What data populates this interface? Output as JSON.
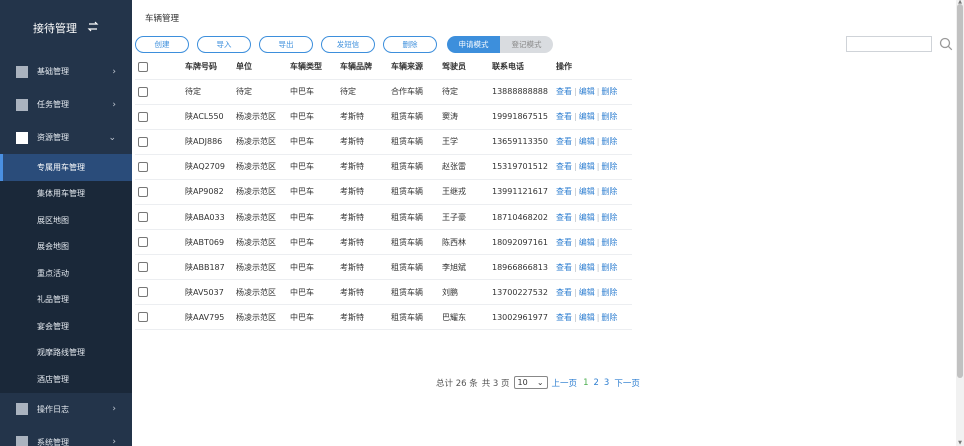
{
  "sidebar": {
    "brand": "接待管理",
    "swap_icon": "swap-icon",
    "groups": [
      {
        "label": "基础管理",
        "chevron": "›"
      },
      {
        "label": "任务管理",
        "chevron": "›"
      },
      {
        "label": "资源管理",
        "chevron": "⌄"
      },
      {
        "label": "操作日志",
        "chevron": "›"
      },
      {
        "label": "系统管理",
        "chevron": "›"
      }
    ],
    "subitems": [
      "专属用车管理",
      "集体用车管理",
      "展区地图",
      "展会地图",
      "重点活动",
      "礼品管理",
      "宴会管理",
      "观摩路线管理",
      "酒店管理"
    ]
  },
  "page": {
    "title": "车辆管理"
  },
  "toolbar": {
    "buttons": [
      "创建",
      "导入",
      "导出",
      "发短信",
      "删除"
    ],
    "mode_on": "申请模式",
    "mode_off": "登记模式",
    "search_placeholder": ""
  },
  "table": {
    "headers": [
      "车牌号码",
      "单位",
      "车辆类型",
      "车辆品牌",
      "车辆来源",
      "驾驶员",
      "联系电话",
      "操作"
    ],
    "actions": [
      "查看",
      "编辑",
      "删除"
    ],
    "rows": [
      [
        "待定",
        "待定",
        "中巴车",
        "待定",
        "合作车辆",
        "待定",
        "13888888888"
      ],
      [
        "陕ACL550",
        "杨凌示范区",
        "中巴车",
        "考斯特",
        "租赁车辆",
        "窦涛",
        "19991867515"
      ],
      [
        "陕ADJ886",
        "杨凌示范区",
        "中巴车",
        "考斯特",
        "租赁车辆",
        "王学",
        "13659113350"
      ],
      [
        "陕AQ2709",
        "杨凌示范区",
        "中巴车",
        "考斯特",
        "租赁车辆",
        "赵张雷",
        "15319701512"
      ],
      [
        "陕AP9082",
        "杨凌示范区",
        "中巴车",
        "考斯特",
        "租赁车辆",
        "王继戎",
        "13991121617"
      ],
      [
        "陕ABA033",
        "杨凌示范区",
        "中巴车",
        "考斯特",
        "租赁车辆",
        "王子豪",
        "18710468202"
      ],
      [
        "陕ABT069",
        "杨凌示范区",
        "中巴车",
        "考斯特",
        "租赁车辆",
        "陈西林",
        "18092097161"
      ],
      [
        "陕ABB187",
        "杨凌示范区",
        "中巴车",
        "考斯特",
        "租赁车辆",
        "李旭斌",
        "18966866813"
      ],
      [
        "陕AV5037",
        "杨凌示范区",
        "中巴车",
        "考斯特",
        "租赁车辆",
        "刘鹏",
        "13700227532"
      ],
      [
        "陕AAV795",
        "杨凌示范区",
        "中巴车",
        "考斯特",
        "租赁车辆",
        "巴耀东",
        "13002961977"
      ]
    ]
  },
  "pager": {
    "total": "总计 26 条",
    "pages": "共 3 页",
    "page_size": "10",
    "prev": "上一页",
    "page_numbers": [
      "1",
      "2",
      "3"
    ],
    "next": "下一页",
    "current_page": "1"
  },
  "colors": {
    "sidebar_bg": "#23344a",
    "accent": "#3d8fdc",
    "active_item": "#2a4c7a",
    "link": "#2f7fd1",
    "current_page": "#4caf50"
  }
}
